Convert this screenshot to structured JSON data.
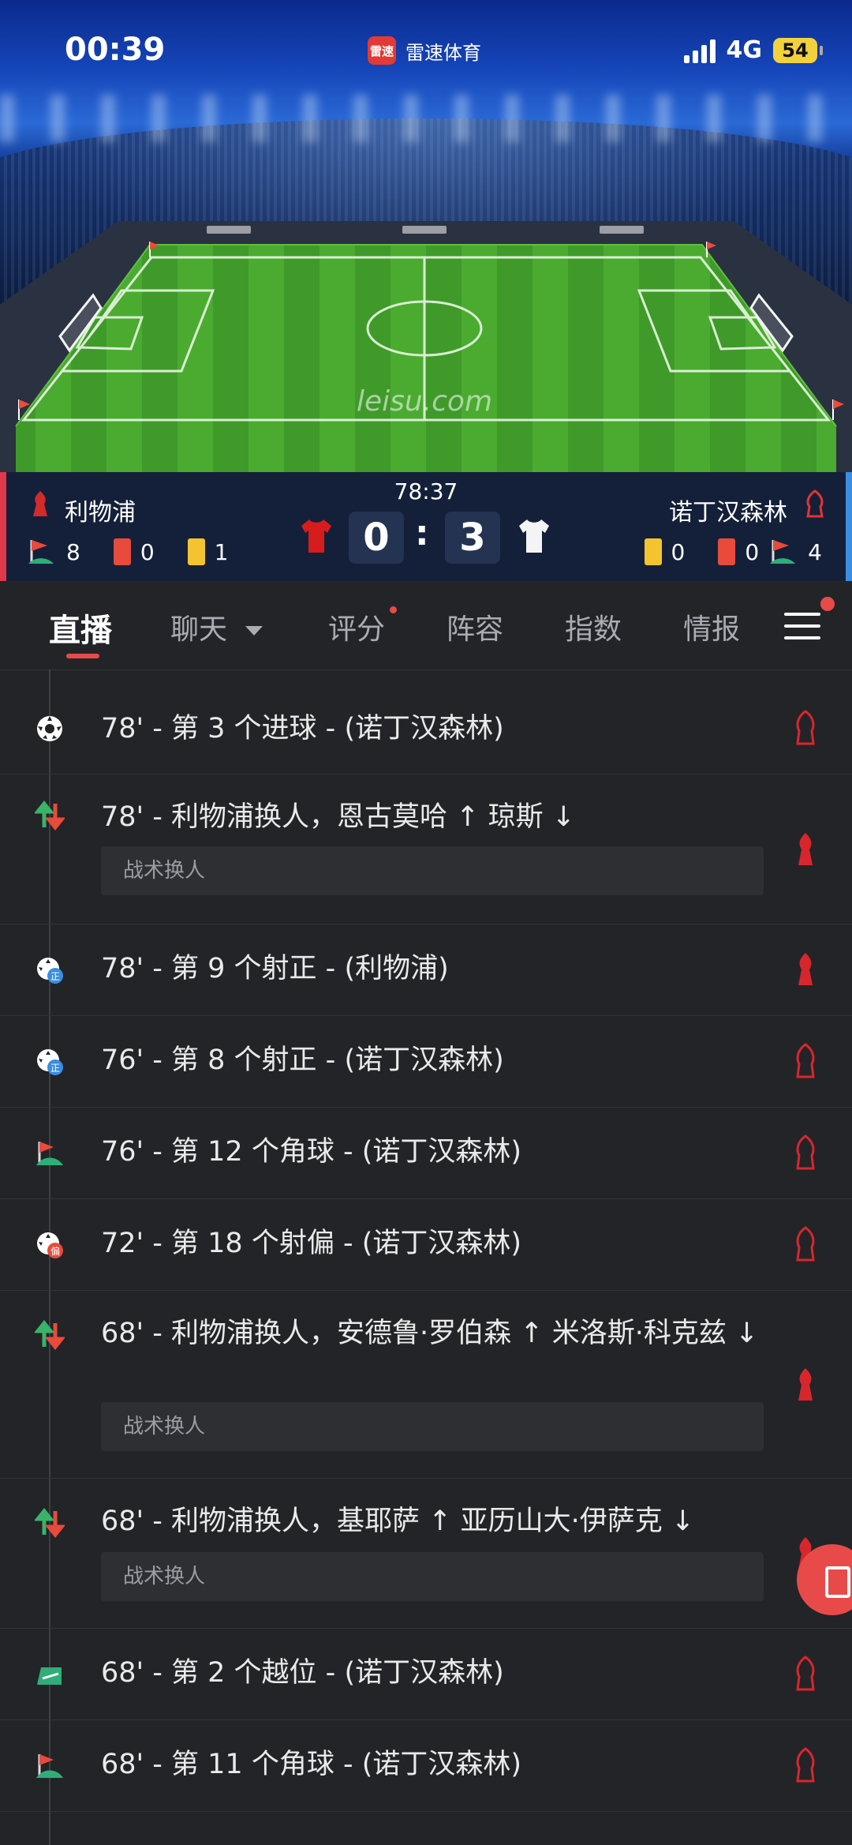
{
  "status_bar": {
    "time": "00:39",
    "app_name": "雷速体育",
    "app_logo_text": "雷速",
    "network": "4G",
    "battery": "54"
  },
  "pitch": {
    "watermark": "leisu.com"
  },
  "match": {
    "minute": "78:37",
    "home": {
      "name": "利物浦",
      "score": "0",
      "corners": "8",
      "red_cards": "0",
      "yellow_cards": "1",
      "color": "#c8102e"
    },
    "away": {
      "name": "诺丁汉森林",
      "score": "3",
      "corners": "4",
      "red_cards": "0",
      "yellow_cards": "0",
      "color": "#e53233"
    }
  },
  "tabs": [
    {
      "label": "直播",
      "active": true
    },
    {
      "label": "聊天"
    },
    {
      "label": "评分"
    },
    {
      "label": "阵容"
    },
    {
      "label": "指数"
    },
    {
      "label": "情报"
    }
  ],
  "events": [
    {
      "icon": "goal-ball-icon",
      "text": "78' - 第 3 个进球 - (诺丁汉森林)",
      "team": "away"
    },
    {
      "icon": "substitution-icon",
      "text": "78' - 利物浦换人，恩古莫哈 ↑ 琼斯 ↓",
      "sub": "战术换人",
      "team": "home"
    },
    {
      "icon": "shot-on-target-icon",
      "text": "78' - 第 9 个射正 - (利物浦)",
      "team": "home"
    },
    {
      "icon": "shot-on-target-icon",
      "text": "76' - 第 8 个射正 - (诺丁汉森林)",
      "team": "away"
    },
    {
      "icon": "corner-flag-icon",
      "text": "76' - 第 12 个角球 - (诺丁汉森林)",
      "team": "away"
    },
    {
      "icon": "shot-off-target-icon",
      "text": "72' - 第 18 个射偏 - (诺丁汉森林)",
      "team": "away"
    },
    {
      "icon": "substitution-icon",
      "text": "68' - 利物浦换人，安德鲁·罗伯森 ↑ 米洛斯·科克兹 ↓",
      "sub": "战术换人",
      "team": "home"
    },
    {
      "icon": "substitution-icon",
      "text": "68' - 利物浦换人，基耶萨 ↑ 亚历山大·伊萨克 ↓",
      "sub": "战术换人",
      "team": "home"
    },
    {
      "icon": "offside-icon",
      "text": "68' - 第 2 个越位 - (诺丁汉森林)",
      "team": "away"
    },
    {
      "icon": "corner-flag-icon",
      "text": "68' - 第 11 个角球 - (诺丁汉森林)",
      "team": "away"
    }
  ]
}
